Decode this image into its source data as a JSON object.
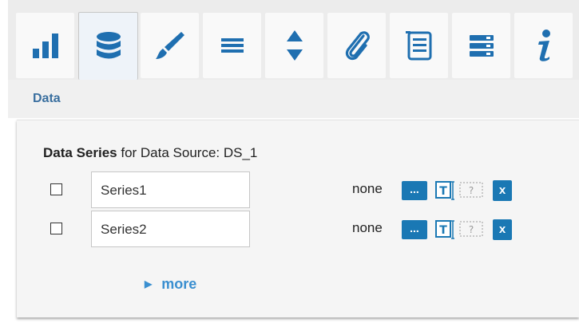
{
  "toolbar": {
    "tabs": [
      {
        "name": "bar-chart-icon"
      },
      {
        "name": "database-icon",
        "active": true
      },
      {
        "name": "brush-icon"
      },
      {
        "name": "menu-lines-icon"
      },
      {
        "name": "sort-arrows-icon"
      },
      {
        "name": "paperclip-icon"
      },
      {
        "name": "list-icon"
      },
      {
        "name": "server-rows-icon"
      },
      {
        "name": "info-icon"
      }
    ]
  },
  "breadcrumb": {
    "label": "Data"
  },
  "panel": {
    "heading_bold": "Data Series",
    "heading_rest": " for Data Source: DS_1",
    "series": [
      {
        "name": "Series1",
        "checked": false,
        "mapping": "none",
        "dots_label": "...",
        "delete_label": "x"
      },
      {
        "name": "Series2",
        "checked": false,
        "mapping": "none",
        "dots_label": "...",
        "delete_label": "x"
      }
    ],
    "more_label": "more"
  },
  "colors": {
    "accent": "#1a78b4",
    "icon": "#1f6fb0",
    "link": "#3a8fd0",
    "breadcrumb": "#3a6f9f"
  }
}
